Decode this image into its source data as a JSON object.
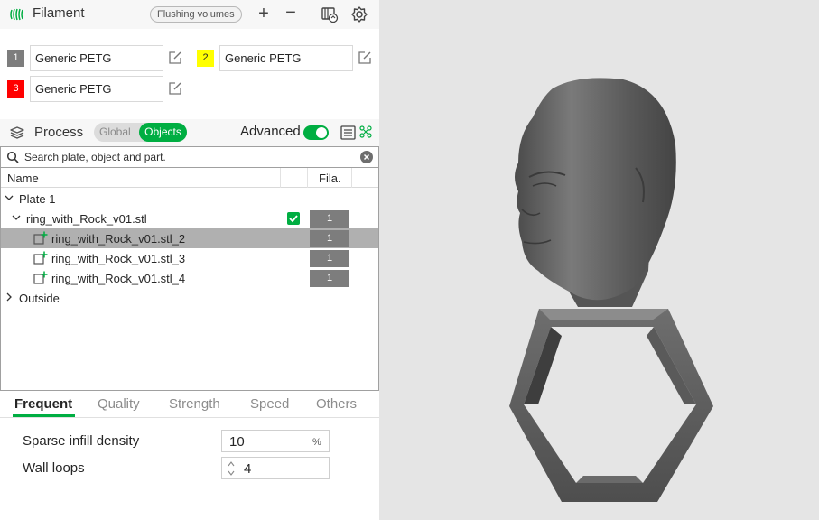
{
  "filament": {
    "title": "Filament",
    "flushing_label": "Flushing volumes",
    "add_label": "+",
    "remove_label": "−",
    "slots": [
      {
        "number": "1",
        "name": "Generic PETG",
        "color": "#7d7d7d",
        "text_color": "#ffffff"
      },
      {
        "number": "2",
        "name": "Generic PETG",
        "color": "#ffff00",
        "text_color": "#262626"
      },
      {
        "number": "3",
        "name": "Generic PETG",
        "color": "#ff0000",
        "text_color": "#ffffff"
      }
    ]
  },
  "process": {
    "title": "Process",
    "seg_global": "Global",
    "seg_objects": "Objects",
    "advanced_label": "Advanced",
    "advanced_on": true
  },
  "search": {
    "placeholder": "Search plate, object and part."
  },
  "tree": {
    "col_name": "Name",
    "col_fila": "Fila.",
    "plate": "Plate 1",
    "object": {
      "name": "ring_with_Rock_v01.stl",
      "filament": "1",
      "checked": true
    },
    "parts": [
      {
        "name": "ring_with_Rock_v01.stl_2",
        "filament": "1",
        "selected": true
      },
      {
        "name": "ring_with_Rock_v01.stl_3",
        "filament": "1",
        "selected": false
      },
      {
        "name": "ring_with_Rock_v01.stl_4",
        "filament": "1",
        "selected": false
      }
    ],
    "outside": "Outside"
  },
  "tabs": [
    "Frequent",
    "Quality",
    "Strength",
    "Speed",
    "Others"
  ],
  "active_tab": "Frequent",
  "settings": {
    "infill_label": "Sparse infill density",
    "infill_value": "10",
    "infill_unit": "%",
    "walls_label": "Wall loops",
    "walls_value": "4"
  },
  "colors": {
    "accent": "#00ae42",
    "viewport_bg": "#e5e5e5",
    "model": "#5f5f5f"
  }
}
